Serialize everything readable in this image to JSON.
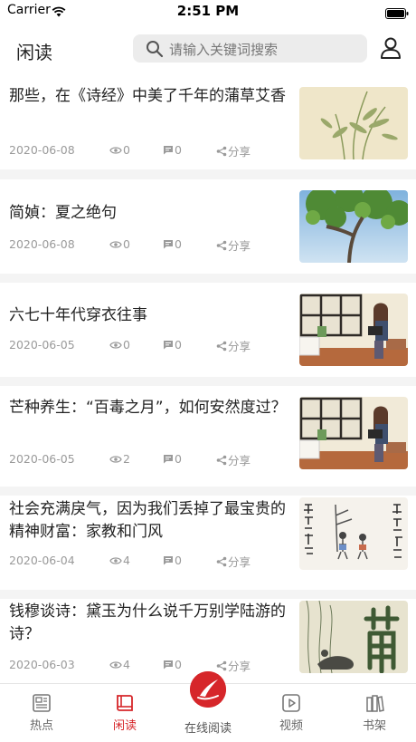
{
  "status_bar": {
    "carrier": "Carrier",
    "time": "2:51 PM"
  },
  "header": {
    "title": "闲读",
    "search_placeholder": "请输入关键词搜索"
  },
  "articles": [
    {
      "title": "那些，在《诗经》中美了千年的蒲草艾香",
      "date": "2020-06-08",
      "views": "0",
      "comments": "0",
      "share": "分享"
    },
    {
      "title": "简媜：夏之绝句",
      "date": "2020-06-08",
      "views": "0",
      "comments": "0",
      "share": "分享"
    },
    {
      "title": "六七十年代穿衣往事",
      "date": "2020-06-05",
      "views": "0",
      "comments": "0",
      "share": "分享"
    },
    {
      "title": "芒种养生：“百毒之月”，如何安然度过？",
      "date": "2020-06-05",
      "views": "2",
      "comments": "0",
      "share": "分享"
    },
    {
      "title": "社会充满戾气，因为我们丢掉了最宝贵的精神财富：家教和门风",
      "date": "2020-06-04",
      "views": "4",
      "comments": "0",
      "share": "分享"
    },
    {
      "title": "钱穆谈诗：黛玉为什么说千万别学陆游的诗？",
      "date": "2020-06-03",
      "views": "4",
      "comments": "0",
      "share": "分享"
    }
  ],
  "tabbar": {
    "tabs": [
      {
        "label": "热点"
      },
      {
        "label": "闲读"
      },
      {
        "label": "在线阅读"
      },
      {
        "label": "视频"
      },
      {
        "label": "书架"
      }
    ]
  },
  "colors": {
    "accent": "#d6262a",
    "background": "#f4f4f4",
    "meta_text": "#9a9a9a"
  }
}
